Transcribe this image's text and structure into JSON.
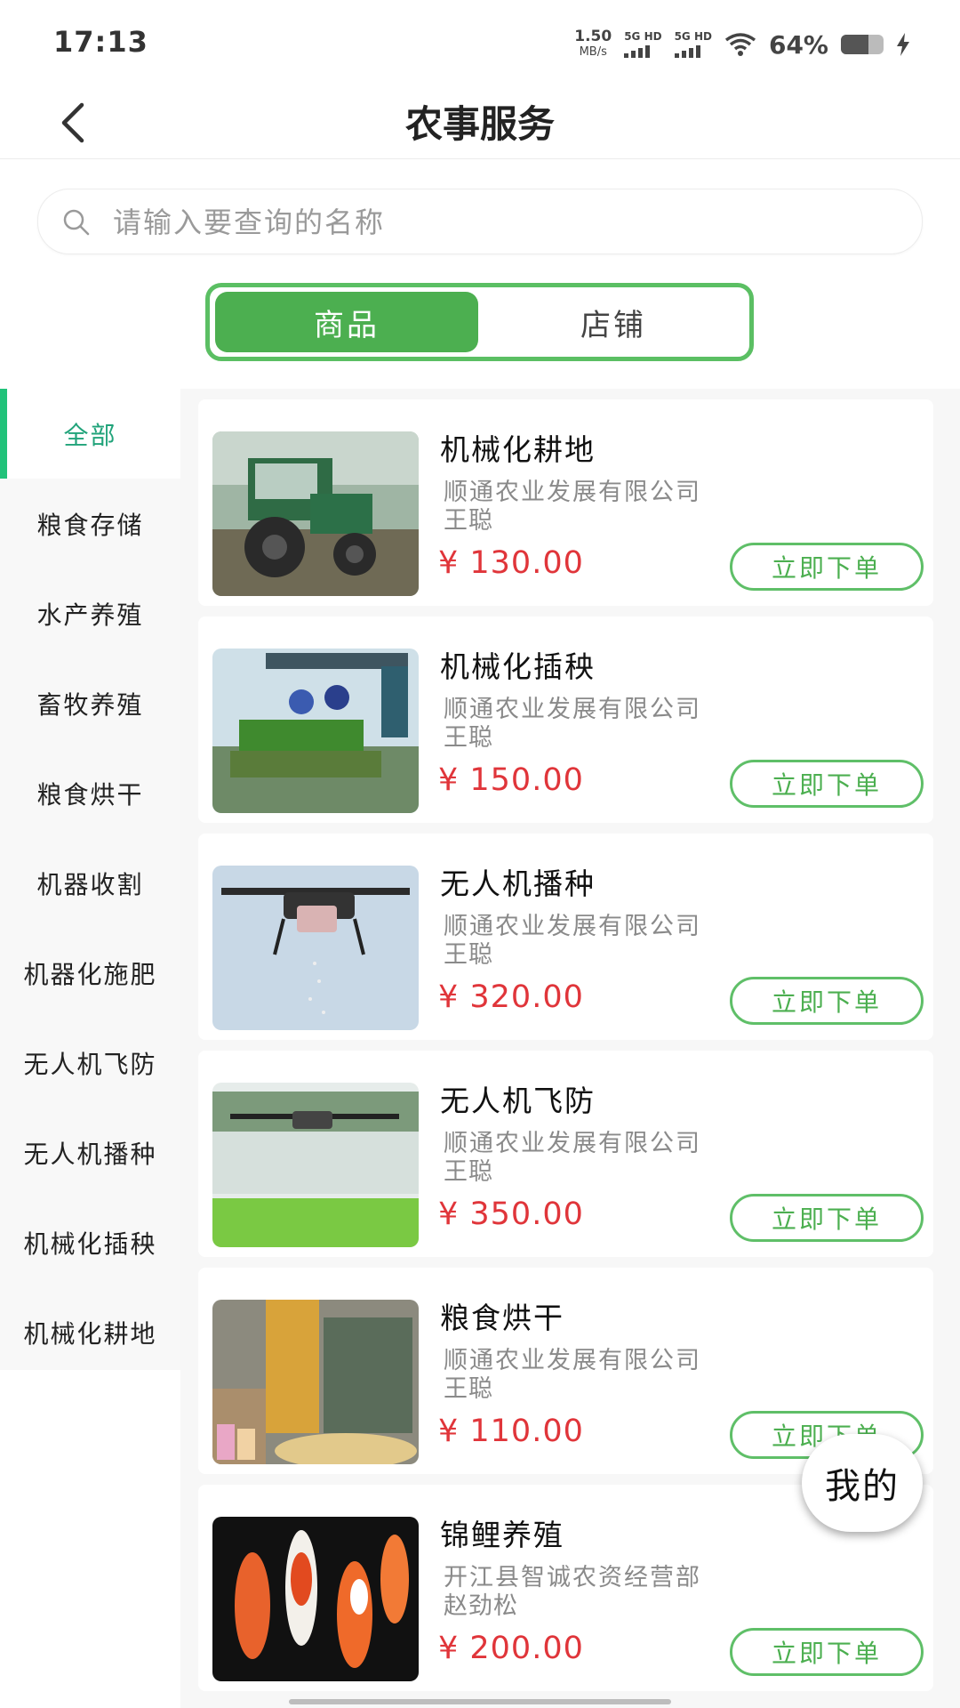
{
  "status_bar": {
    "time": "17:13",
    "net_speed": "1.50",
    "net_unit": "MB/s",
    "sim1": "5G HD",
    "sim2": "5G HD",
    "battery": "64%",
    "battery_level": 0.64
  },
  "header": {
    "title": "农事服务"
  },
  "search": {
    "placeholder": "请输入要查询的名称"
  },
  "tabs": [
    {
      "label": "商品",
      "active": true
    },
    {
      "label": "店铺",
      "active": false
    }
  ],
  "sidebar": {
    "items": [
      {
        "label": "全部",
        "active": true
      },
      {
        "label": "粮食存储"
      },
      {
        "label": "水产养殖"
      },
      {
        "label": "畜牧养殖"
      },
      {
        "label": "粮食烘干"
      },
      {
        "label": "机器收割"
      },
      {
        "label": "机器化施肥"
      },
      {
        "label": "无人机飞防"
      },
      {
        "label": "无人机播种"
      },
      {
        "label": "机械化插秧"
      },
      {
        "label": "机械化耕地"
      }
    ]
  },
  "products": [
    {
      "title": "机械化耕地",
      "shop": "顺通农业发展有限公司",
      "person": "王聪",
      "price": "¥ 130.00",
      "button": "立即下单",
      "image": "tractor"
    },
    {
      "title": "机械化插秧",
      "shop": "顺通农业发展有限公司",
      "person": "王聪",
      "price": "¥ 150.00",
      "button": "立即下单",
      "image": "rice-transplanter"
    },
    {
      "title": "无人机播种",
      "shop": "顺通农业发展有限公司",
      "person": "王聪",
      "price": "¥ 320.00",
      "button": "立即下单",
      "image": "seeding-drone"
    },
    {
      "title": "无人机飞防",
      "shop": "顺通农业发展有限公司",
      "person": "王聪",
      "price": "¥ 350.00",
      "button": "立即下单",
      "image": "spraying-drone"
    },
    {
      "title": "粮食烘干",
      "shop": "顺通农业发展有限公司",
      "person": "王聪",
      "price": "¥ 110.00",
      "button": "立即下单",
      "image": "grain-dryer"
    },
    {
      "title": "锦鲤养殖",
      "shop": "开江县智诚农资经营部",
      "person": "赵劲松",
      "price": "¥ 200.00",
      "button": "立即下单",
      "image": "koi-fish"
    }
  ],
  "fab": {
    "label": "我的"
  },
  "colors": {
    "accent": "#4caf50",
    "price": "#e0353a",
    "sidebar_active": "#21a37a"
  }
}
